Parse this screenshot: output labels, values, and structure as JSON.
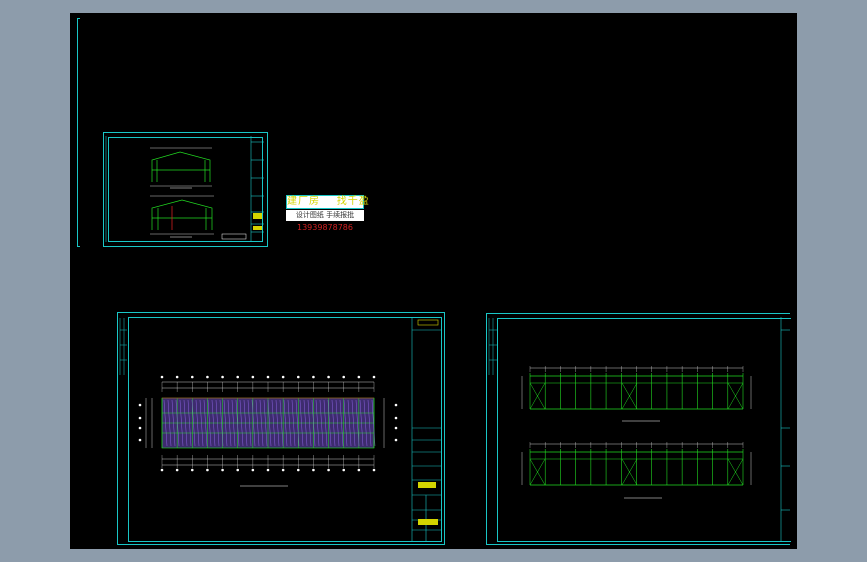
{
  "stamp": {
    "title_line": "建厂房    找千盈",
    "sub_line": "设计图纸 手续报批",
    "phone": "13939878786"
  },
  "colors": {
    "background": "#8d9cab",
    "canvas": "#000000",
    "frame": "#19c6c6",
    "structure": "#22dd22",
    "dimension": "#ffffff",
    "accent": "#d02020"
  }
}
